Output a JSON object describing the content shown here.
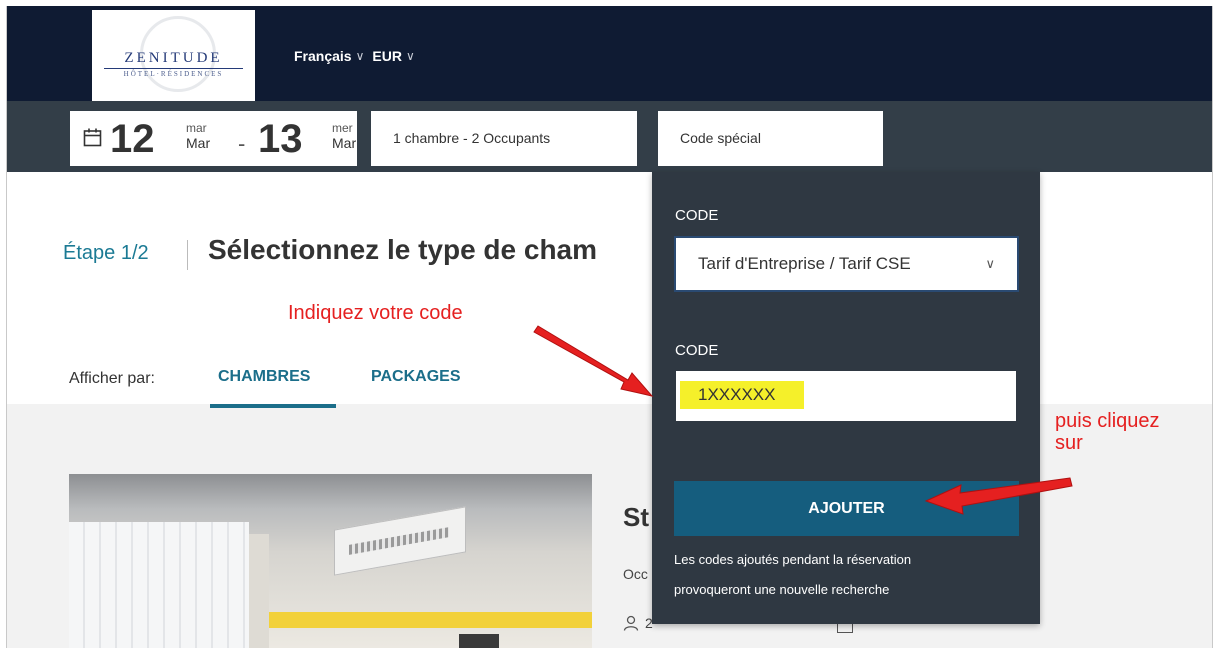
{
  "header": {
    "logo": {
      "name": "ZENITUDE",
      "subtitle": "HÔTEL·RÉSIDENCES"
    },
    "language": "Français",
    "currency": "EUR"
  },
  "booking": {
    "checkin": {
      "weekday": "mar",
      "day": "12",
      "month": "Mar"
    },
    "checkout": {
      "weekday": "mer",
      "day": "13",
      "month": "Mar"
    },
    "rooms_label": "1 chambre - 2 Occupants",
    "code_label": "Code spécial"
  },
  "main": {
    "step": "Étape 1/2",
    "title": "Sélectionnez le type de cham",
    "display_by_label": "Afficher par:",
    "tabs": [
      {
        "label": "CHAMBRES",
        "active": true
      },
      {
        "label": "PACKAGES",
        "active": false
      }
    ],
    "room": {
      "title": "St",
      "occupancy": "Occ",
      "guests": "2"
    }
  },
  "code_panel": {
    "type_label": "CODE",
    "type_selected": "Tarif d'Entreprise / Tarif CSE",
    "code_label": "CODE",
    "code_value": "1XXXXXX",
    "submit_label": "AJOUTER",
    "note_line1": "Les codes ajoutés pendant la réservation",
    "note_line2": "provoqueront une nouvelle recherche"
  },
  "annotations": {
    "code_hint": "Indiquez votre code",
    "click_hint_line1": "puis cliquez",
    "click_hint_line2": "sur",
    "color": "#e52020"
  },
  "colors": {
    "topbar": "#0f1b33",
    "bookbar": "#333e48",
    "panel": "#2f3842",
    "accent": "#1b6e8a",
    "button": "#155d7e"
  }
}
